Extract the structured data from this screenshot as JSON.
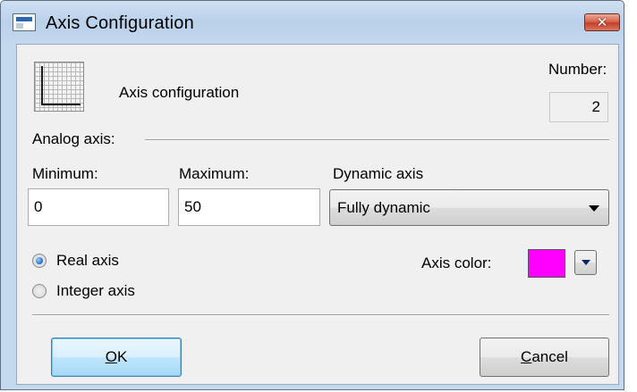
{
  "window": {
    "title": "Axis Configuration",
    "close_glyph": "✕"
  },
  "header": {
    "caption": "Axis configuration",
    "number_label": "Number:",
    "number_value": "2"
  },
  "analog_axis": {
    "section_label": "Analog axis:",
    "minimum_label": "Minimum:",
    "minimum_value": "0",
    "maximum_label": "Maximum:",
    "maximum_value": "50",
    "dynamic_label": "Dynamic axis",
    "dynamic_value": "Fully dynamic"
  },
  "axis_type": {
    "options": [
      {
        "label": "Real axis",
        "checked": true
      },
      {
        "label": "Integer axis",
        "checked": false
      }
    ]
  },
  "axis_color": {
    "label": "Axis color:",
    "value": "#ff00ff"
  },
  "buttons": {
    "ok_accel": "O",
    "ok_rest": "K",
    "cancel_accel": "C",
    "cancel_rest": "ancel"
  },
  "icons": {
    "app": "dialog-window-icon",
    "axis": "axis-grid-icon",
    "close": "close-icon",
    "combo_arrow": "chevron-down-icon",
    "color_drop": "chevron-down-icon"
  }
}
